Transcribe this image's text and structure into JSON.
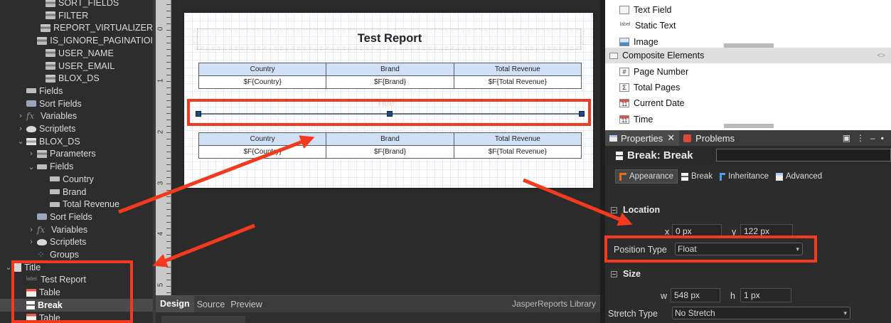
{
  "outline": {
    "items": [
      {
        "label": "SORT_FIELDS",
        "indent": 3,
        "icon": "parameter-icon",
        "twisty": ""
      },
      {
        "label": "FILTER",
        "indent": 3,
        "icon": "parameter-icon",
        "twisty": ""
      },
      {
        "label": "REPORT_VIRTUALIZER",
        "indent": 3,
        "icon": "parameter-icon",
        "twisty": ""
      },
      {
        "label": "IS_IGNORE_PAGINATIOI",
        "indent": 3,
        "icon": "parameter-icon",
        "twisty": ""
      },
      {
        "label": "USER_NAME",
        "indent": 3,
        "icon": "parameter-icon",
        "twisty": ""
      },
      {
        "label": "USER_EMAIL",
        "indent": 3,
        "icon": "parameter-icon",
        "twisty": ""
      },
      {
        "label": "BLOX_DS",
        "indent": 3,
        "icon": "parameter-icon",
        "twisty": ""
      },
      {
        "label": "Fields",
        "indent": 1,
        "icon": "field-icon",
        "twisty": ""
      },
      {
        "label": "Sort Fields",
        "indent": 1,
        "icon": "sort-icon",
        "twisty": ""
      },
      {
        "label": "Variables",
        "indent": 1,
        "icon": "fx-icon",
        "twisty": ">"
      },
      {
        "label": "Scriptlets",
        "indent": 1,
        "icon": "scriptlet-icon",
        "twisty": ">"
      },
      {
        "label": "BLOX_DS",
        "indent": 1,
        "icon": "dataset-icon",
        "twisty": "v"
      },
      {
        "label": "Parameters",
        "indent": 2,
        "icon": "parameter-icon",
        "twisty": ">"
      },
      {
        "label": "Fields",
        "indent": 2,
        "icon": "field-icon",
        "twisty": "v"
      },
      {
        "label": "Country",
        "indent": 4,
        "icon": "field-icon",
        "twisty": ""
      },
      {
        "label": "Brand",
        "indent": 4,
        "icon": "field-icon",
        "twisty": ""
      },
      {
        "label": "Total Revenue",
        "indent": 4,
        "icon": "field-icon",
        "twisty": ""
      },
      {
        "label": "Sort Fields",
        "indent": 2,
        "icon": "sort-icon",
        "twisty": ""
      },
      {
        "label": "Variables",
        "indent": 2,
        "icon": "fx-icon",
        "twisty": ">"
      },
      {
        "label": "Scriptlets",
        "indent": 2,
        "icon": "scriptlet-icon",
        "twisty": ">"
      },
      {
        "label": "Groups",
        "indent": 2,
        "icon": "groups-icon",
        "twisty": ""
      },
      {
        "label": "Title",
        "indent": 0,
        "icon": "title-band-icon",
        "twisty": "v"
      },
      {
        "label": "Test Report",
        "indent": 1,
        "icon": "label-icon",
        "twisty": ""
      },
      {
        "label": "Table",
        "indent": 1,
        "icon": "table-icon",
        "twisty": ""
      },
      {
        "label": "Break",
        "indent": 1,
        "icon": "break-icon",
        "twisty": "",
        "selected": true
      },
      {
        "label": "Table",
        "indent": 1,
        "icon": "table-icon",
        "twisty": ""
      }
    ]
  },
  "ruler": {
    "marks": [
      "0",
      "1",
      "2",
      "3",
      "4",
      "5"
    ]
  },
  "report": {
    "title": "Test Report",
    "band_watermark": "Title",
    "table1": {
      "headers": [
        "Country",
        "Brand",
        "Total Revenue"
      ],
      "cells": [
        "$F{Country}",
        "$F{Brand}",
        "$F{Total Revenue}"
      ]
    },
    "table2": {
      "headers": [
        "Country",
        "Brand",
        "Total Revenue"
      ],
      "cells": [
        "$F{Country}",
        "$F{Brand}",
        "$F{Total Revenue}"
      ]
    }
  },
  "designer_tabs": {
    "design": "Design",
    "source": "Source",
    "preview": "Preview",
    "library": "JasperReports Library"
  },
  "palette": {
    "text_field": "Text Field",
    "static_text": "Static Text",
    "image": "Image",
    "composite": "Composite Elements",
    "page_number": "Page Number",
    "total_pages": "Total Pages",
    "current_date": "Current Date",
    "time": "Time",
    "icons": {
      "static_text": "label",
      "page_number": "#",
      "total_pages": "Σ",
      "current_date": "11",
      "time": "11"
    }
  },
  "properties": {
    "tab_label": "Properties",
    "tab_close": "✕",
    "problems_label": "Problems",
    "header_title": "Break: Break",
    "sub_tabs": {
      "appearance": "Appearance",
      "break": "Break",
      "inheritance": "Inheritance",
      "advanced": "Advanced"
    },
    "location": {
      "title": "Location",
      "x_label": "x",
      "x_value": "0 px",
      "y_label": "y",
      "y_value": "122 px",
      "position_type_label": "Position Type",
      "position_type_value": "Float"
    },
    "size": {
      "title": "Size",
      "w_label": "w",
      "w_value": "548 px",
      "h_label": "h",
      "h_value": "1 px",
      "stretch_type_label": "Stretch Type",
      "stretch_type_value": "No Stretch"
    }
  },
  "colors": {
    "annotation_red": "#f3391e",
    "table_header_bg": "#cfe0f7",
    "selection_handle": "#1d4a80"
  }
}
